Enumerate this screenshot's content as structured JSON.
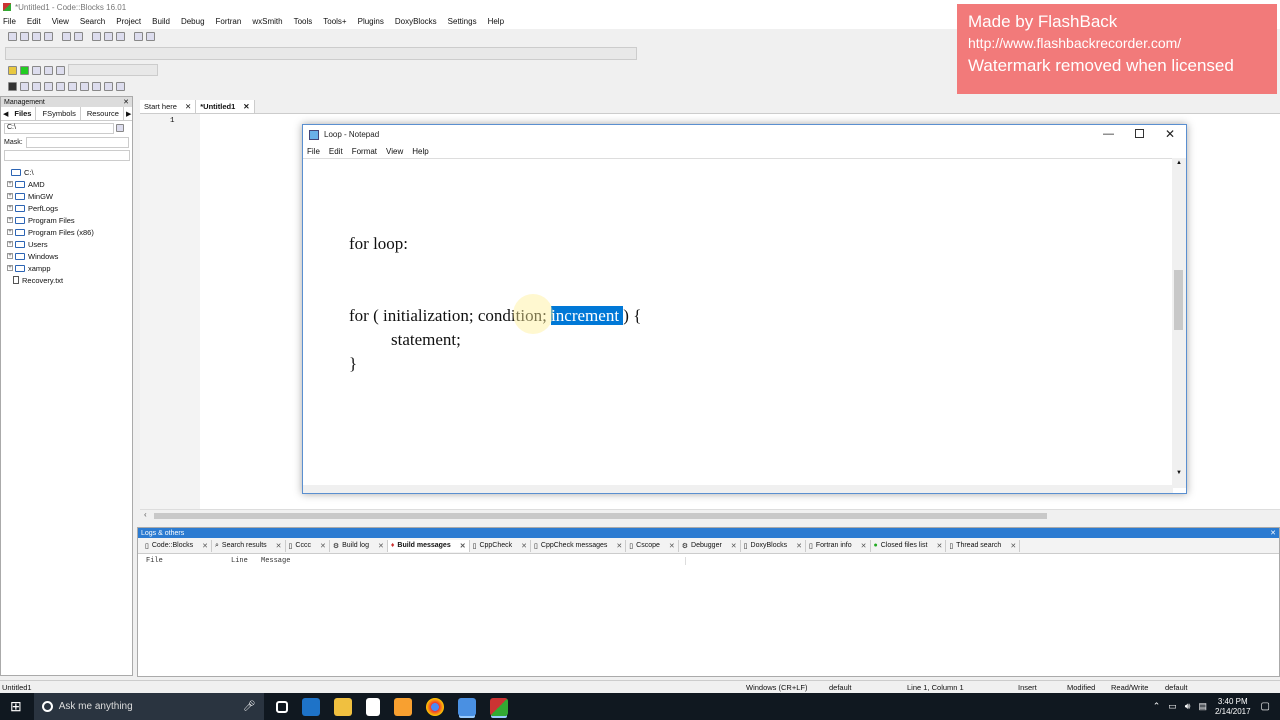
{
  "window": {
    "title": "*Untitled1 - Code::Blocks 16.01"
  },
  "menu": [
    "File",
    "Edit",
    "View",
    "Search",
    "Project",
    "Build",
    "Debug",
    "Fortran",
    "wxSmith",
    "Tools",
    "Tools+",
    "Plugins",
    "DoxyBlocks",
    "Settings",
    "Help"
  ],
  "management": {
    "title": "Management",
    "tabs": [
      "Files",
      "FSymbols",
      "Resource"
    ],
    "path": "C:\\",
    "mask_label": "Mask:",
    "tree": [
      "C:\\",
      "AMD",
      "MinGW",
      "PerfLogs",
      "Program Files",
      "Program Files (x86)",
      "Users",
      "Windows",
      "xampp",
      "Recovery.txt"
    ]
  },
  "editor": {
    "tabs": [
      "Start here",
      "*Untitled1"
    ],
    "line_number": "1"
  },
  "notepad": {
    "title": "Loop - Notepad",
    "menu": [
      "File",
      "Edit",
      "Format",
      "View",
      "Help"
    ],
    "line1": "for loop:",
    "line2_a": "for ( initialization; condition; ",
    "line2_sel": "increment ",
    "line2_b": ") {",
    "line3": "statement;",
    "line4": "}"
  },
  "watermark": {
    "line1": "Made by FlashBack",
    "line2": "http://www.flashbackrecorder.com/",
    "line3": "Watermark removed when licensed"
  },
  "logs": {
    "title": "Logs & others",
    "tabs": [
      "Code::Blocks",
      "Search results",
      "Cccc",
      "Build log",
      "Build messages",
      "CppCheck",
      "CppCheck messages",
      "Cscope",
      "Debugger",
      "DoxyBlocks",
      "Fortran info",
      "Closed files list",
      "Thread search"
    ],
    "columns": [
      "File",
      "Line",
      "Message"
    ]
  },
  "statusbar": {
    "file": "Untitled1",
    "eol": "Windows (CR+LF)",
    "encoding": "default",
    "position": "Line 1, Column 1",
    "mode": "Insert",
    "modified": "Modified",
    "access": "Read/Write",
    "lang": "default"
  },
  "taskbar": {
    "search_placeholder": "Ask me anything",
    "time": "3:40 PM",
    "date": "2/14/2017"
  },
  "colors": {
    "selection": "#0078d7",
    "watermark": "#f27a7a",
    "panel_header": "#2b7bd1",
    "taskbar": "#101820"
  }
}
